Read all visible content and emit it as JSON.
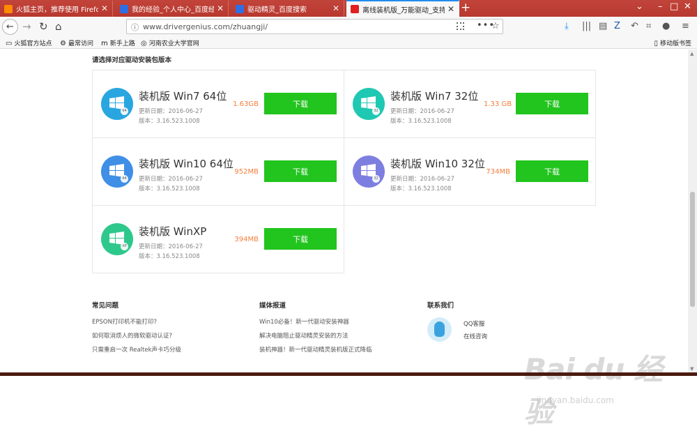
{
  "tabs": [
    {
      "title": "火狐主页，推荐使用 Firefox",
      "favicon_color": "#ff8a00",
      "active": false
    },
    {
      "title": "我的经验_个人中心_百度经验",
      "favicon_color": "#2f6fe4",
      "active": false
    },
    {
      "title": "驱动精灵_百度搜索",
      "favicon_color": "#2f6fe4",
      "active": false
    },
    {
      "title": "离线装机版_万能驱动_支持系统",
      "favicon_color": "#e02020",
      "active": true
    }
  ],
  "url": "www.drivergenius.com/zhuangji/",
  "bookmarks": [
    "火狐官方站点",
    "最常访问",
    "新手上路",
    "河南农业大学官网"
  ],
  "mobile_bookmarks": "移动版书签",
  "section_title": "请选择对应驱动安装包版本",
  "cards": [
    {
      "name": "装机版 Win7 64位",
      "date": "更新日期：2016-06-27",
      "version": "版本：3.16.523.1008",
      "size": "1.63GB",
      "download": "下载",
      "badge": "64",
      "color": "#29a6e0"
    },
    {
      "name": "装机版 Win7 32位",
      "date": "更新日期：2016-06-27",
      "version": "版本：3.16.523.1008",
      "size": "1.33 GB",
      "download": "下载",
      "badge": "32",
      "color": "#1fc8b2"
    },
    {
      "name": "装机版 Win10 64位",
      "date": "更新日期：2016-06-27",
      "version": "版本：3.16.523.1008",
      "size": "952MB",
      "download": "下载",
      "badge": "64",
      "color": "#3f8fe6"
    },
    {
      "name": "装机版 Win10 32位",
      "date": "更新日期：2016-06-27",
      "version": "版本：3.16.523.1008",
      "size": "734MB",
      "download": "下载",
      "badge": "32",
      "color": "#7d7fe0"
    },
    {
      "name": "装机版 WinXP",
      "date": "更新日期：2016-06-27",
      "version": "版本：3.16.523.1008",
      "size": "394MB",
      "download": "下载",
      "badge": "XP",
      "color": "#2fc88c"
    }
  ],
  "footer": {
    "faq_title": "常见问题",
    "faq": [
      "EPSON打印机不能打印?",
      "如何取消烦人的微软驱动认证?",
      "只需重启一次 Realtek声卡巧分级"
    ],
    "media_title": "媒体报道",
    "media": [
      "Win10必备！新一代驱动安装神器",
      "解决电脑阻止驱动精灵安装的方法",
      "装机神器！新一代驱动精灵装机版正式降临"
    ],
    "contact_title": "联系我们",
    "contact": [
      "QQ客服",
      "在线咨询"
    ]
  },
  "watermark": "Bai du 经验",
  "watermark_sub": "jingyan.baidu.com"
}
